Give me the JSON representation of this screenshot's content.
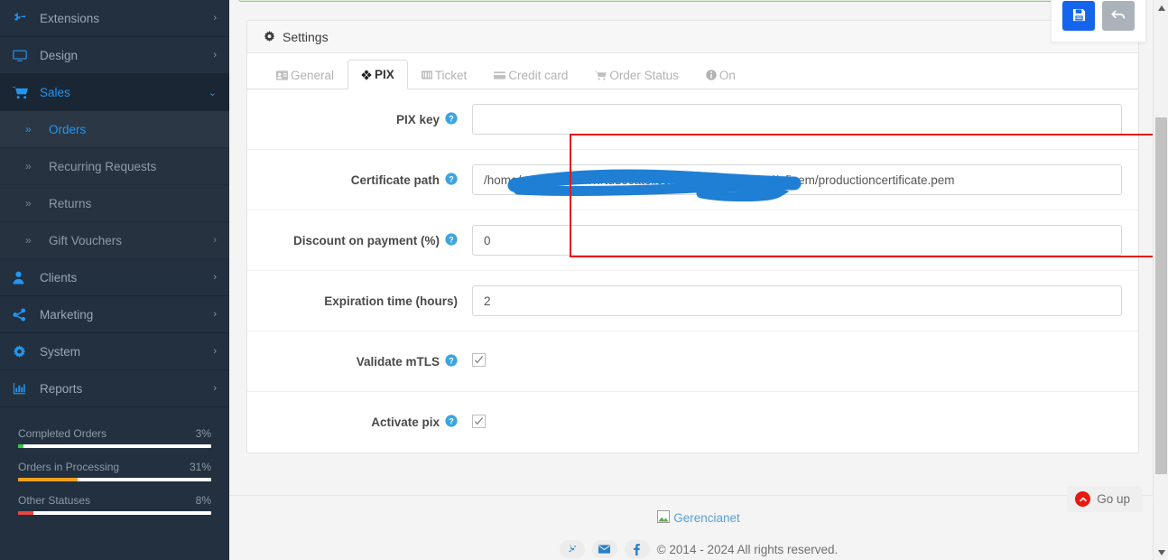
{
  "sidebar": {
    "items": [
      {
        "label": "Extensions",
        "icon": "puzzle-icon",
        "caret": "›",
        "state": "normal"
      },
      {
        "label": "Design",
        "icon": "monitor-icon",
        "caret": "›",
        "state": "normal"
      },
      {
        "label": "Sales",
        "icon": "cart-icon",
        "caret": "⌄",
        "state": "active"
      }
    ],
    "subitems": [
      {
        "label": "Orders",
        "marker": "»",
        "caret": "",
        "state": "current"
      },
      {
        "label": "Recurring Requests",
        "marker": "»",
        "caret": "",
        "state": "normal"
      },
      {
        "label": "Returns",
        "marker": "»",
        "caret": "",
        "state": "normal"
      },
      {
        "label": "Gift Vouchers",
        "marker": "»",
        "caret": "›",
        "state": "normal"
      }
    ],
    "items2": [
      {
        "label": "Clients",
        "icon": "user-icon",
        "caret": "›"
      },
      {
        "label": "Marketing",
        "icon": "share-icon",
        "caret": "›"
      },
      {
        "label": "System",
        "icon": "gear-icon",
        "caret": "›"
      },
      {
        "label": "Reports",
        "icon": "barchart-icon",
        "caret": "›"
      }
    ],
    "stats": [
      {
        "label": "Completed Orders",
        "value": "3%",
        "percent": 3,
        "color": "#2ecc40"
      },
      {
        "label": "Orders in Processing",
        "value": "31%",
        "percent": 31,
        "color": "#f0a01e"
      },
      {
        "label": "Other Statuses",
        "value": "8%",
        "percent": 8,
        "color": "#e8473f"
      }
    ]
  },
  "panel": {
    "title": "Settings",
    "title_icon": "gear-icon"
  },
  "tabs": [
    {
      "label": "General",
      "icon": "id-card-icon",
      "selected": false
    },
    {
      "label": "PIX",
      "icon": "pix-diamond-icon",
      "selected": true
    },
    {
      "label": "Ticket",
      "icon": "barcode-icon",
      "selected": false
    },
    {
      "label": "Credit card",
      "icon": "creditcard-icon",
      "selected": false
    },
    {
      "label": "Order Status",
      "icon": "cart-icon",
      "selected": false
    },
    {
      "label": "On",
      "icon": "info-icon",
      "selected": false
    }
  ],
  "form": {
    "fields": [
      {
        "label": "PIX key",
        "type": "text",
        "value": "",
        "help": true,
        "redacted": true
      },
      {
        "label": "Certificate path",
        "type": "text",
        "value": "/home/customer/www/tudocatolico.com.br/public_html/efipem/productioncertificate.pem",
        "help": true,
        "redacted": false
      },
      {
        "label": "Discount on payment (%)",
        "type": "text",
        "value": "0",
        "help": true,
        "redacted": false
      },
      {
        "label": "Expiration time (hours)",
        "type": "text",
        "value": "2",
        "help": false,
        "redacted": false
      },
      {
        "label": "Validate mTLS",
        "type": "checkbox",
        "checked": true,
        "help": true,
        "redacted": false
      },
      {
        "label": "Activate pix",
        "type": "checkbox",
        "checked": true,
        "help": true,
        "redacted": false
      }
    ],
    "help_icon": "help-circle-icon"
  },
  "toolbar": {
    "save_label": "Save",
    "save_icon": "floppy-disk-icon",
    "back_label": "Back",
    "back_icon": "undo-arrow-icon"
  },
  "goup": {
    "label": "Go up",
    "icon": "chevron-up-circle-icon"
  },
  "footer": {
    "brand": "Gerencianet",
    "brand_icon": "broken-image-icon",
    "copyright": "© 2014 - 2024 All rights reserved.",
    "social": [
      {
        "name": "plug-icon"
      },
      {
        "name": "envelope-icon"
      },
      {
        "name": "facebook-icon"
      }
    ]
  },
  "scrollbar": {
    "up_icon": "triangle-up-icon",
    "down_icon": "triangle-down-icon"
  },
  "colors": {
    "sidebar_bg": "#23303f",
    "accent_blue": "#2196f3",
    "highlight_red": "#e8190f",
    "primary_button": "#1565ec",
    "redaction_blue": "#1f7fd4"
  }
}
